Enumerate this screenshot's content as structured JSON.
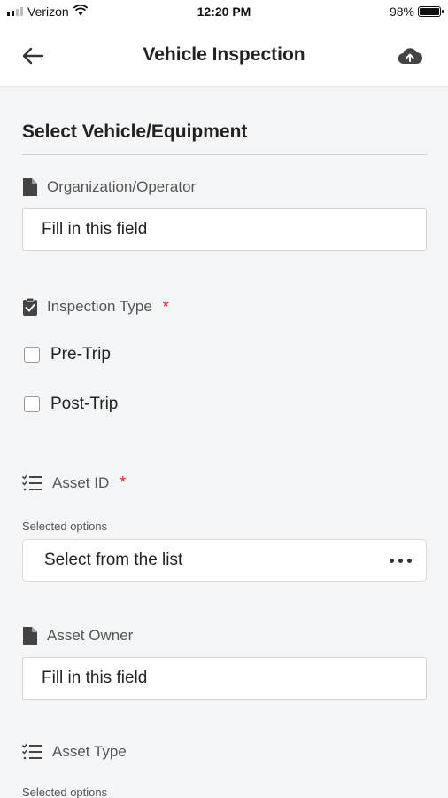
{
  "status_bar": {
    "carrier": "Verizon",
    "time": "12:20 PM",
    "battery": "98%",
    "battery_level": 0.98
  },
  "app_bar": {
    "title": "Vehicle Inspection",
    "back_icon": "arrow-left-icon",
    "upload_icon": "cloud-upload-icon"
  },
  "section": {
    "title": "Select Vehicle/Equipment"
  },
  "fields": {
    "organization": {
      "label": "Organization/Operator",
      "placeholder": "Fill in this field",
      "icon": "document-icon"
    },
    "inspection_type": {
      "label": "Inspection Type",
      "required_mark": "*",
      "icon": "clipboard-check-icon",
      "options": [
        {
          "label": "Pre-Trip",
          "checked": false
        },
        {
          "label": "Post-Trip",
          "checked": false
        }
      ]
    },
    "asset_id": {
      "label": "Asset ID",
      "required_mark": "*",
      "icon": "checklist-icon",
      "sub_label": "Selected options",
      "placeholder": "Select from the list"
    },
    "asset_owner": {
      "label": "Asset Owner",
      "placeholder": "Fill in this field",
      "icon": "document-icon"
    },
    "asset_type": {
      "label": "Asset Type",
      "icon": "checklist-icon",
      "sub_label": "Selected options"
    }
  }
}
